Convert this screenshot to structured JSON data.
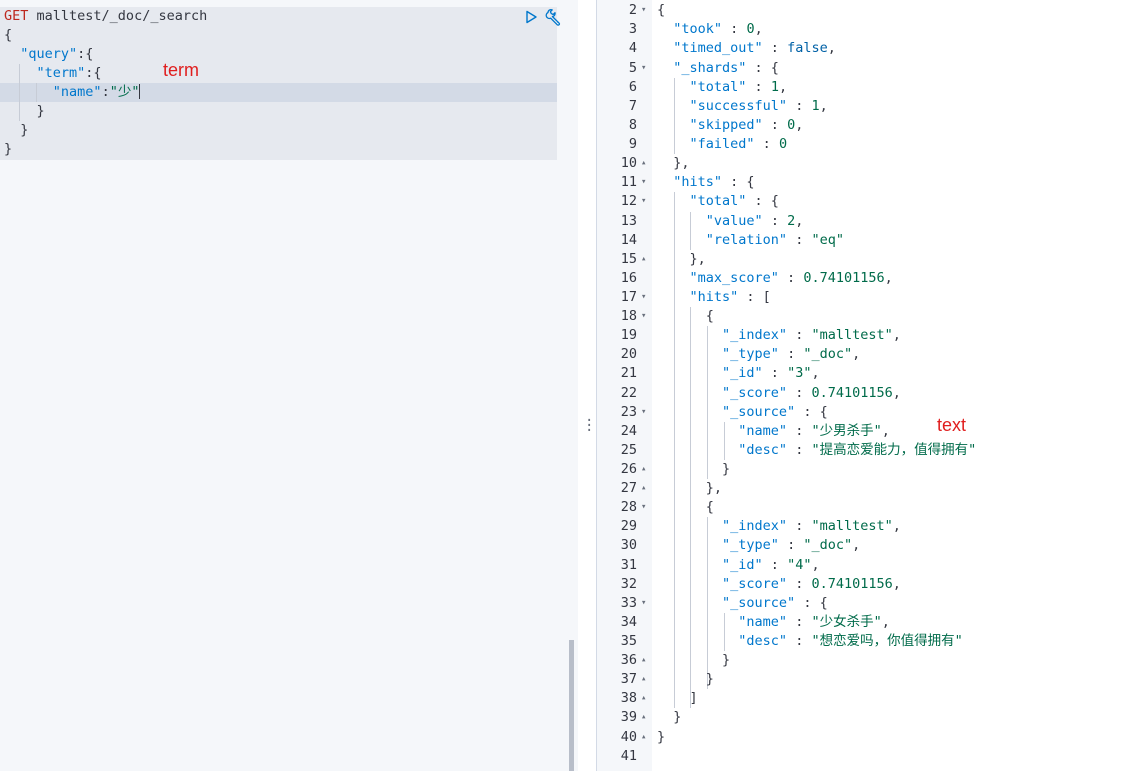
{
  "request": {
    "method": "GET",
    "path": "malltest/_doc/_search",
    "lines": [
      "{",
      "  \"query\":{",
      "    \"term\":{",
      "      \"name\":\"少\"",
      "    }",
      "  }",
      "}"
    ],
    "run_icon": "play-icon",
    "settings_icon": "wrench-icon"
  },
  "annotations": {
    "left": "term",
    "right": "text"
  },
  "response": {
    "line_numbers": [
      "2",
      "3",
      "4",
      "5",
      "6",
      "7",
      "8",
      "9",
      "10",
      "11",
      "12",
      "13",
      "14",
      "15",
      "16",
      "17",
      "18",
      "19",
      "20",
      "21",
      "22",
      "23",
      "24",
      "25",
      "26",
      "27",
      "28",
      "29",
      "30",
      "31",
      "32",
      "33",
      "34",
      "35",
      "36",
      "37",
      "38",
      "39",
      "40",
      "41"
    ],
    "took": "0",
    "timed_out": "false",
    "shards": {
      "total": "1",
      "successful": "1",
      "skipped": "0",
      "failed": "0"
    },
    "hits_total": {
      "value": "2",
      "relation": "\"eq\""
    },
    "max_score": "0.74101156",
    "hits": [
      {
        "index": "\"malltest\"",
        "type": "\"_doc\"",
        "id": "\"3\"",
        "score": "0.74101156",
        "name": "\"少男杀手\"",
        "desc": "\"提高恋爱能力，值得拥有\""
      },
      {
        "index": "\"malltest\"",
        "type": "\"_doc\"",
        "id": "\"4\"",
        "score": "0.74101156",
        "name": "\"少女杀手\"",
        "desc": "\"想恋爱吗，你值得拥有\""
      }
    ]
  },
  "colors": {
    "key": "#0077cc",
    "string": "#006b4a",
    "method": "#bd271e",
    "annotation": "#e01e1e"
  }
}
